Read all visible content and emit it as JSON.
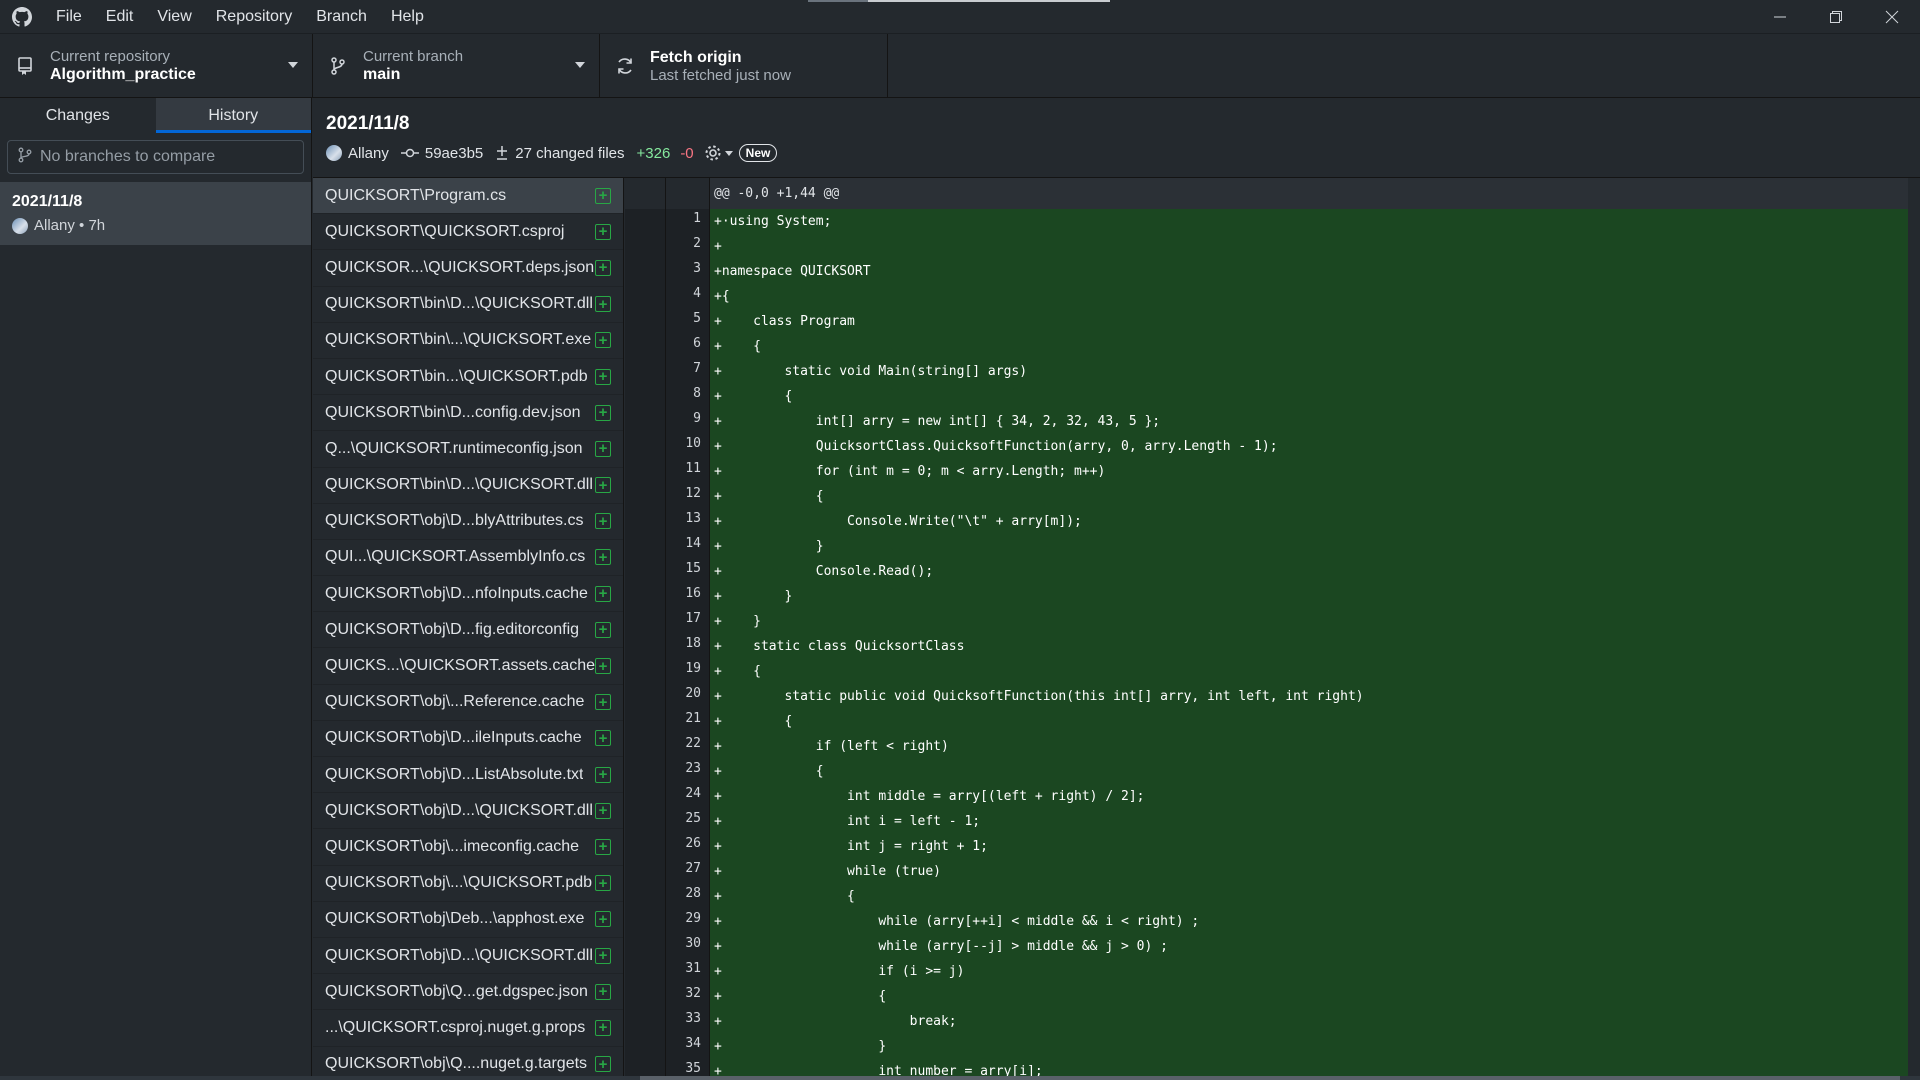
{
  "menu": [
    "File",
    "Edit",
    "View",
    "Repository",
    "Branch",
    "Help"
  ],
  "toolbar": {
    "repo_label": "Current repository",
    "repo_value": "Algorithm_practice",
    "branch_label": "Current branch",
    "branch_value": "main",
    "fetch_label": "Fetch origin",
    "fetch_value": "Last fetched just now"
  },
  "sidebar": {
    "tabs": [
      "Changes",
      "History"
    ],
    "active_tab": "History",
    "compare_placeholder": "No branches to compare",
    "commit": {
      "title": "2021/11/8",
      "meta": "Allany • 7h"
    }
  },
  "commit_header": {
    "title": "2021/11/8",
    "author": "Allany",
    "sha": "59ae3b5",
    "changed": "27 changed files",
    "additions": "+326",
    "deletions": "-0",
    "badge": "New"
  },
  "files": [
    "QUICKSORT\\Program.cs",
    "QUICKSORT\\QUICKSORT.csproj",
    "QUICKSOR...\\QUICKSORT.deps.json",
    "QUICKSORT\\bin\\D...\\QUICKSORT.dll",
    "QUICKSORT\\bin\\...\\QUICKSORT.exe",
    "QUICKSORT\\bin...\\QUICKSORT.pdb",
    "QUICKSORT\\bin\\D...config.dev.json",
    "Q...\\QUICKSORT.runtimeconfig.json",
    "QUICKSORT\\bin\\D...\\QUICKSORT.dll",
    "QUICKSORT\\obj\\D...blyAttributes.cs",
    "QUI...\\QUICKSORT.AssemblyInfo.cs",
    "QUICKSORT\\obj\\D...nfoInputs.cache",
    "QUICKSORT\\obj\\D...fig.editorconfig",
    "QUICKS...\\QUICKSORT.assets.cache",
    "QUICKSORT\\obj\\...Reference.cache",
    "QUICKSORT\\obj\\D...ileInputs.cache",
    "QUICKSORT\\obj\\D...ListAbsolute.txt",
    "QUICKSORT\\obj\\D...\\QUICKSORT.dll",
    "QUICKSORT\\obj\\...imeconfig.cache",
    "QUICKSORT\\obj\\...\\QUICKSORT.pdb",
    "QUICKSORT\\obj\\Deb...\\apphost.exe",
    "QUICKSORT\\obj\\D...\\QUICKSORT.dll",
    "QUICKSORT\\obj\\Q...get.dgspec.json",
    "...\\QUICKSORT.csproj.nuget.g.props",
    "QUICKSORT\\obj\\Q....nuget.g.targets"
  ],
  "selected_file_index": 0,
  "diff": {
    "hunk": "@@ -0,0 +1,44 @@",
    "lines": [
      {
        "n": "1",
        "code": "+·using System;"
      },
      {
        "n": "2",
        "code": "+"
      },
      {
        "n": "3",
        "code": "+namespace QUICKSORT"
      },
      {
        "n": "4",
        "code": "+{"
      },
      {
        "n": "5",
        "code": "+    class Program"
      },
      {
        "n": "6",
        "code": "+    {"
      },
      {
        "n": "7",
        "code": "+        static void Main(string[] args)"
      },
      {
        "n": "8",
        "code": "+        {"
      },
      {
        "n": "9",
        "code": "+            int[] arry = new int[] { 34, 2, 32, 43, 5 };"
      },
      {
        "n": "10",
        "code": "+            QuicksortClass.QuicksoftFunction(arry, 0, arry.Length - 1);"
      },
      {
        "n": "11",
        "code": "+            for (int m = 0; m < arry.Length; m++)"
      },
      {
        "n": "12",
        "code": "+            {"
      },
      {
        "n": "13",
        "code": "+                Console.Write(\"\\t\" + arry[m]);"
      },
      {
        "n": "14",
        "code": "+            }"
      },
      {
        "n": "15",
        "code": "+            Console.Read();"
      },
      {
        "n": "16",
        "code": "+        }"
      },
      {
        "n": "17",
        "code": "+    }"
      },
      {
        "n": "18",
        "code": "+    static class QuicksortClass"
      },
      {
        "n": "19",
        "code": "+    {"
      },
      {
        "n": "20",
        "code": "+        static public void QuicksoftFunction(this int[] arry, int left, int right)"
      },
      {
        "n": "21",
        "code": "+        {"
      },
      {
        "n": "22",
        "code": "+            if (left < right)"
      },
      {
        "n": "23",
        "code": "+            {"
      },
      {
        "n": "24",
        "code": "+                int middle = arry[(left + right) / 2];"
      },
      {
        "n": "25",
        "code": "+                int i = left - 1;"
      },
      {
        "n": "26",
        "code": "+                int j = right + 1;"
      },
      {
        "n": "27",
        "code": "+                while (true)"
      },
      {
        "n": "28",
        "code": "+                {"
      },
      {
        "n": "29",
        "code": "+                    while (arry[++i] < middle && i < right) ;"
      },
      {
        "n": "30",
        "code": "+                    while (arry[--j] > middle && j > 0) ;"
      },
      {
        "n": "31",
        "code": "+                    if (i >= j)"
      },
      {
        "n": "32",
        "code": "+                    {"
      },
      {
        "n": "33",
        "code": "+                        break;"
      },
      {
        "n": "34",
        "code": "+                    }"
      },
      {
        "n": "35",
        "code": "+                    int number = arry[i];"
      }
    ]
  }
}
